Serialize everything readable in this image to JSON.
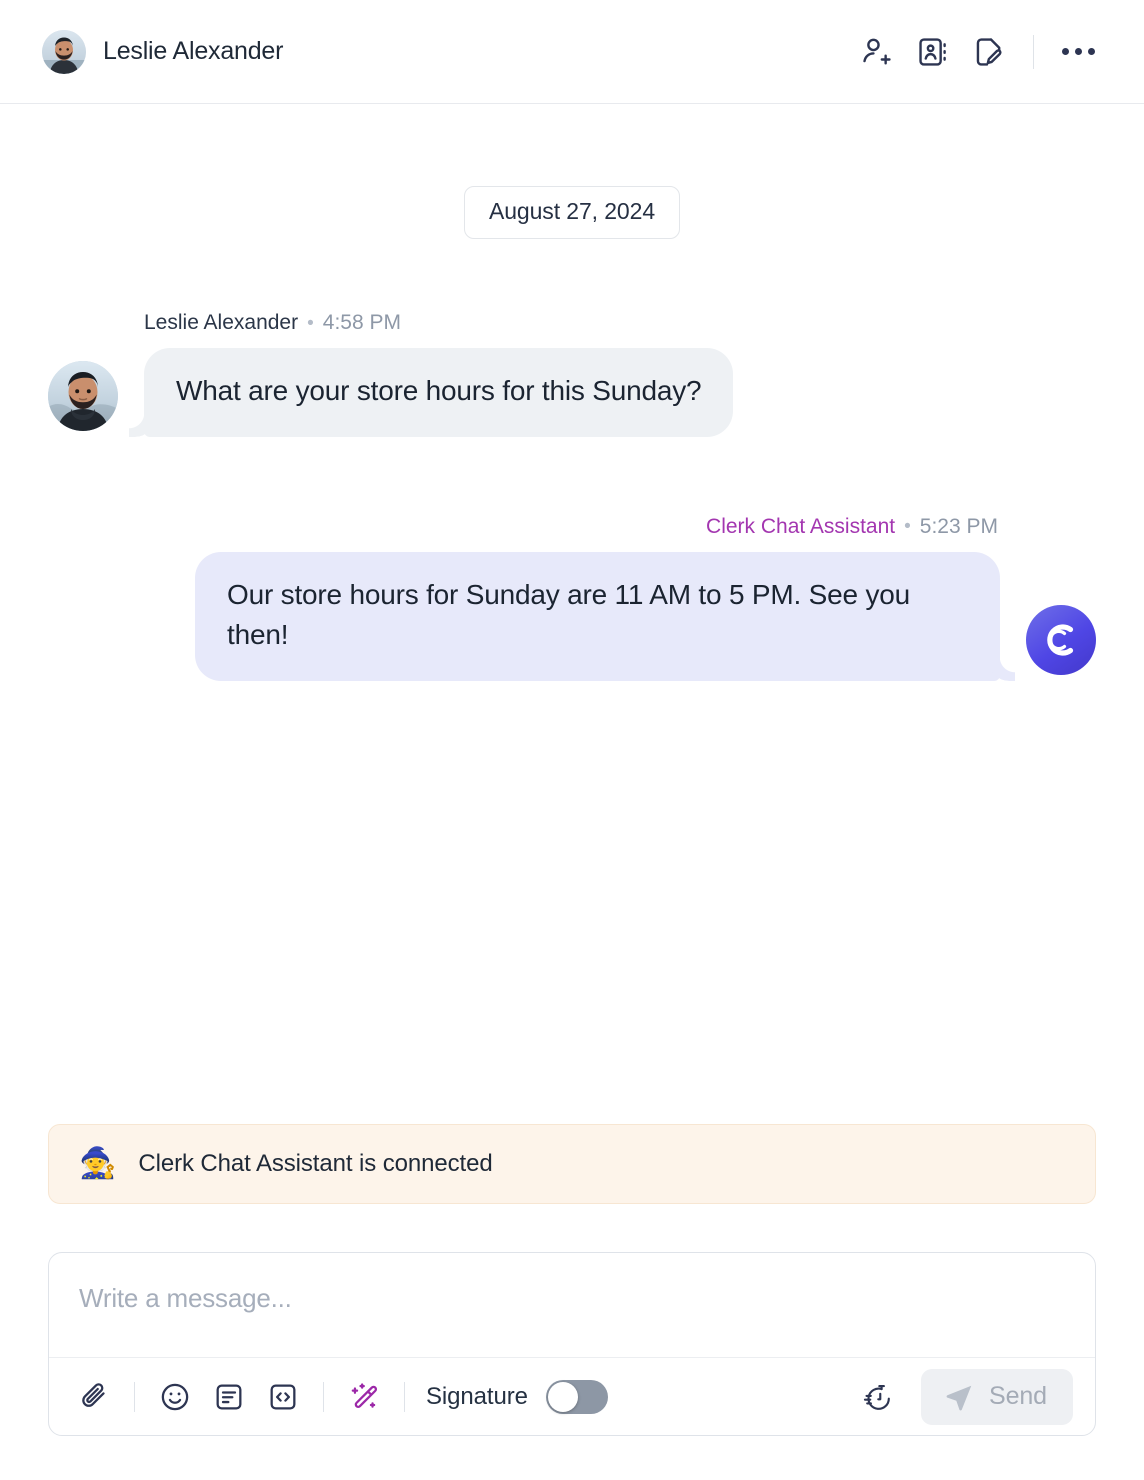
{
  "header": {
    "contact_name": "Leslie Alexander",
    "avatar_name": "leslie-alexander-avatar",
    "actions": [
      {
        "name": "add-contact-icon",
        "label": "Add contact"
      },
      {
        "name": "contact-card-icon",
        "label": "Contact details"
      },
      {
        "name": "note-edit-icon",
        "label": "Edit note"
      }
    ],
    "more_label": "More options"
  },
  "thread": {
    "date_divider": "August 27, 2024",
    "messages": [
      {
        "direction": "incoming",
        "sender": "Leslie Alexander",
        "separator": "•",
        "time": "4:58 PM",
        "text": "What are your store hours for this Sunday?"
      },
      {
        "direction": "outgoing",
        "sender": "Clerk Chat Assistant",
        "separator": "•",
        "time": "5:23 PM",
        "text": "Our store hours for Sunday are 11 AM to 5 PM. See you then!"
      }
    ]
  },
  "banner": {
    "emoji": "🧙",
    "text": "Clerk Chat Assistant is connected"
  },
  "composer": {
    "placeholder": "Write a message...",
    "value": "",
    "tools": [
      {
        "name": "attachment-icon",
        "label": "Attach file"
      },
      {
        "name": "emoji-icon",
        "label": "Emoji"
      },
      {
        "name": "template-icon",
        "label": "Templates"
      },
      {
        "name": "code-icon",
        "label": "Merge field"
      },
      {
        "name": "magic-wand-icon",
        "label": "AI assist"
      }
    ],
    "signature_label": "Signature",
    "signature_on": false,
    "schedule_label": "Schedule send",
    "send_label": "Send",
    "send_enabled": false
  },
  "colors": {
    "accent_purple": "#a336b0",
    "bot_bubble": "#e7e9fa",
    "user_bubble": "#eef1f4",
    "banner_bg": "#fdf4ea",
    "icon_navy": "#2d3552",
    "magic_purple": "#9c28a8"
  }
}
